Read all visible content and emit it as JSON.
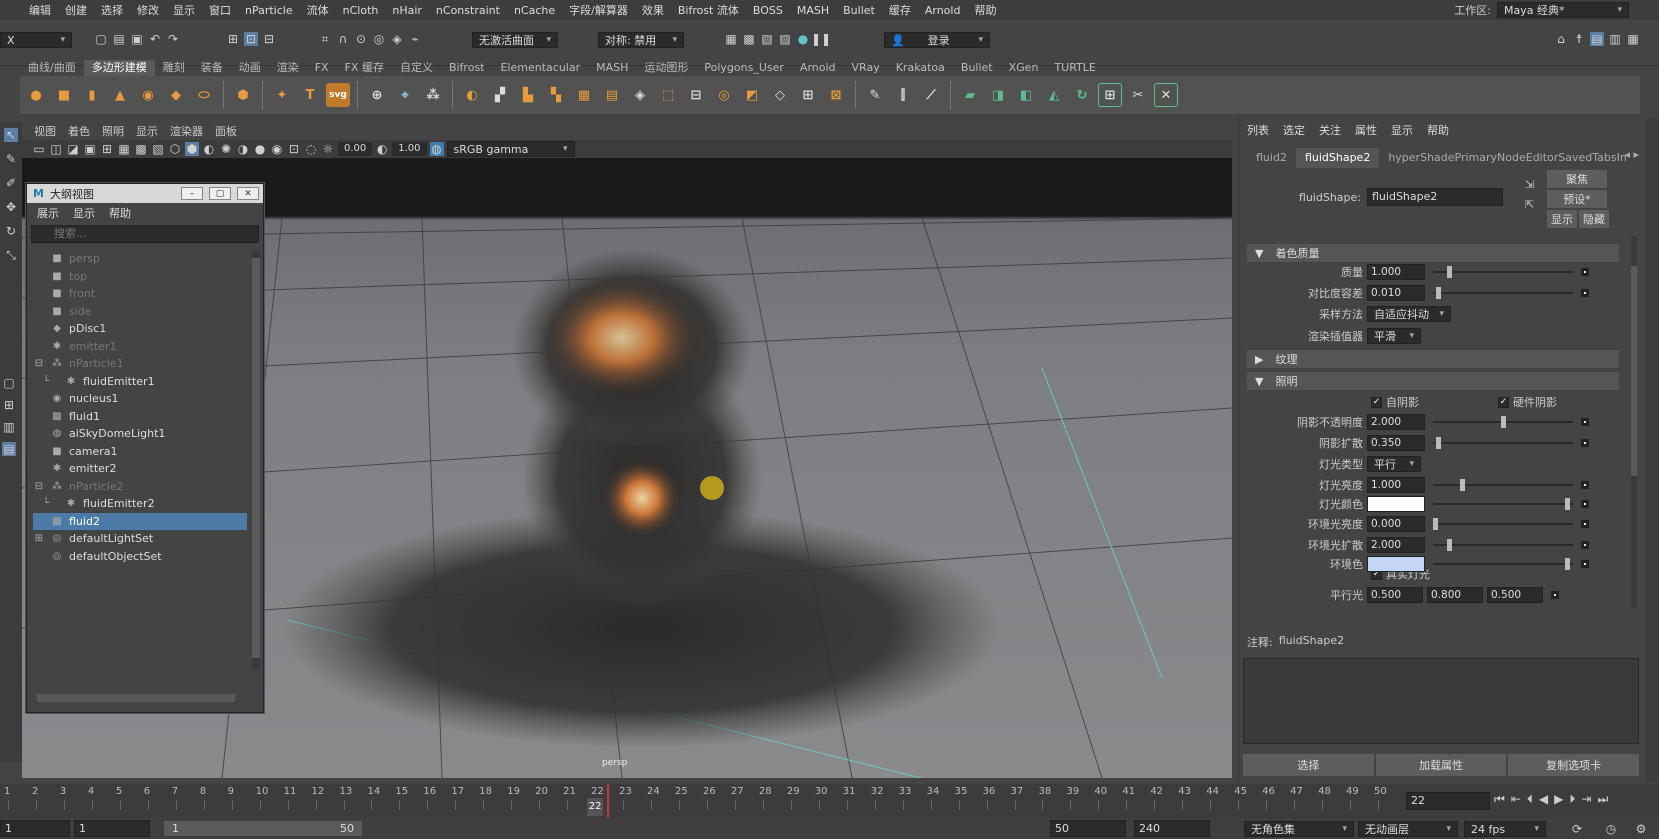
{
  "menubar": {
    "items": [
      "编辑",
      "创建",
      "选择",
      "修改",
      "显示",
      "窗口",
      "nParticle",
      "流体",
      "nCloth",
      "nHair",
      "nConstraint",
      "nCache",
      "字段/解算器",
      "效果",
      "Bifrost 流体",
      "BOSS",
      "MASH",
      "Bullet",
      "缓存",
      "Arnold",
      "帮助"
    ],
    "workspace_label": "工作区:",
    "workspace_value": "Maya 经典*"
  },
  "statusline": {
    "menu_set": "X",
    "live_surface": "无激活曲面",
    "symmetry": "对称: 禁用",
    "login": "登录"
  },
  "shelf": {
    "tabs": [
      "曲线/曲面",
      "多边形建模",
      "雕刻",
      "装备",
      "动画",
      "渲染",
      "FX",
      "FX 缓存",
      "自定义",
      "Bifrost",
      "Elementacular",
      "MASH",
      "运动图形",
      "Polygons_User",
      "Arnold",
      "VRay",
      "Krakatoa",
      "Bullet",
      "XGen",
      "TURTLE"
    ],
    "active_tab": "多边形建模",
    "text_icons": [
      "T",
      "svg"
    ]
  },
  "viewport": {
    "menu": [
      "视图",
      "着色",
      "照明",
      "显示",
      "渲染器",
      "面板"
    ],
    "exposure": "0.00",
    "gamma": "1.00",
    "color_space": "sRGB gamma",
    "camera_label": "persp"
  },
  "outliner": {
    "title": "大纲视图",
    "menu": [
      "展示",
      "显示",
      "帮助"
    ],
    "search_placeholder": "搜索...",
    "items": [
      {
        "label": "persp",
        "icon": "camera-icon",
        "dim": true,
        "indent": 1,
        "expander": ""
      },
      {
        "label": "top",
        "icon": "camera-icon",
        "dim": true,
        "indent": 1,
        "expander": ""
      },
      {
        "label": "front",
        "icon": "camera-icon",
        "dim": true,
        "indent": 1,
        "expander": ""
      },
      {
        "label": "side",
        "icon": "camera-icon",
        "dim": true,
        "indent": 1,
        "expander": ""
      },
      {
        "label": "pDisc1",
        "icon": "mesh-icon",
        "dim": false,
        "indent": 1,
        "expander": ""
      },
      {
        "label": "emitter1",
        "icon": "emitter-icon",
        "dim": true,
        "indent": 1,
        "expander": ""
      },
      {
        "label": "nParticle1",
        "icon": "particle-icon",
        "dim": true,
        "indent": 1,
        "expander": "⊟"
      },
      {
        "label": "fluidEmitter1",
        "icon": "emitter-icon",
        "dim": false,
        "indent": 2,
        "expander": ""
      },
      {
        "label": "nucleus1",
        "icon": "nucleus-icon",
        "dim": false,
        "indent": 1,
        "expander": ""
      },
      {
        "label": "fluid1",
        "icon": "fluid-icon",
        "dim": false,
        "indent": 1,
        "expander": ""
      },
      {
        "label": "aiSkyDomeLight1",
        "icon": "light-icon",
        "dim": false,
        "indent": 1,
        "expander": ""
      },
      {
        "label": "camera1",
        "icon": "camera-icon",
        "dim": false,
        "indent": 1,
        "expander": ""
      },
      {
        "label": "emitter2",
        "icon": "emitter-icon",
        "dim": false,
        "indent": 1,
        "expander": ""
      },
      {
        "label": "nParticle2",
        "icon": "particle-icon",
        "dim": true,
        "indent": 1,
        "expander": "⊟"
      },
      {
        "label": "fluidEmitter2",
        "icon": "emitter-icon",
        "dim": false,
        "indent": 2,
        "expander": ""
      },
      {
        "label": "fluid2",
        "icon": "fluid-icon",
        "dim": false,
        "indent": 1,
        "expander": "",
        "selected": true
      },
      {
        "label": "defaultLightSet",
        "icon": "set-icon",
        "dim": false,
        "indent": 1,
        "expander": "⊞"
      },
      {
        "label": "defaultObjectSet",
        "icon": "set-icon",
        "dim": false,
        "indent": 1,
        "expander": ""
      }
    ]
  },
  "ae": {
    "menu": [
      "列表",
      "选定",
      "关注",
      "属性",
      "显示",
      "帮助"
    ],
    "tabs": [
      "fluid2",
      "fluidShape2",
      "hyperShadePrimaryNodeEditorSavedTabsIn"
    ],
    "active_tab": "fluidShape2",
    "node_label": "fluidShape:",
    "node_value": "fluidShape2",
    "btn_focus": "聚焦",
    "btn_preset": "预设*",
    "btn_show": "显示",
    "btn_hide": "隐藏",
    "sections": {
      "shading_quality": "着色质量",
      "textures": "纹理",
      "lighting": "照明"
    },
    "quality": [
      {
        "label": "质量",
        "value": "1.000",
        "knob": 0.1
      },
      {
        "label": "对比度容差",
        "value": "0.010",
        "knob": 0.02
      }
    ],
    "sample_method": {
      "label": "采样方法",
      "value": "自适应抖动"
    },
    "render_interp": {
      "label": "渲染插值器",
      "value": "平滑"
    },
    "self_shadow": "自阴影",
    "hardware_shadow": "硬件阴影",
    "lighting": [
      {
        "label": "阴影不透明度",
        "value": "2.000",
        "knob": 0.5
      },
      {
        "label": "阴影扩散",
        "value": "0.350",
        "knob": 0.02
      }
    ],
    "light_type": {
      "label": "灯光类型",
      "value": "平行"
    },
    "light_brightness": {
      "label": "灯光亮度",
      "value": "1.000",
      "knob": 0.2
    },
    "light_color": {
      "label": "灯光颜色",
      "color": "#ffffff",
      "knob": 0.98
    },
    "ambient": [
      {
        "label": "环境光亮度",
        "value": "0.000",
        "knob": 0.0
      },
      {
        "label": "环境光扩散",
        "value": "2.000",
        "knob": 0.1
      }
    ],
    "ambient_color": {
      "label": "环境色",
      "color": "#c4d6f4",
      "knob": 0.98
    },
    "real_lights": "真实灯光",
    "directional": {
      "label": "平行光",
      "x": "0.500",
      "y": "0.800",
      "z": "0.500"
    },
    "notes_label": "注释:",
    "notes_node": "fluidShape2",
    "bottom_buttons": [
      "选择",
      "加载属性",
      "复制选项卡"
    ]
  },
  "timeline": {
    "ticks": [
      1,
      2,
      3,
      4,
      5,
      6,
      7,
      8,
      9,
      10,
      11,
      12,
      13,
      14,
      15,
      16,
      17,
      18,
      19,
      20,
      21,
      22,
      23,
      24,
      25,
      26,
      27,
      28,
      29,
      30,
      31,
      32,
      33,
      34,
      35,
      36,
      37,
      38,
      39,
      40,
      41,
      42,
      43,
      44,
      45,
      46,
      47,
      48,
      49,
      50
    ],
    "current": "22",
    "current_field": "22"
  },
  "range": {
    "start": "1",
    "start2": "1",
    "inner_start": "1",
    "inner_end": "50",
    "end": "50",
    "end2": "240",
    "char_set": "无角色集",
    "anim_layer": "无动画层",
    "fps": "24 fps"
  },
  "colors": {
    "accent": "#4c7ba8",
    "bg": "#444444"
  }
}
